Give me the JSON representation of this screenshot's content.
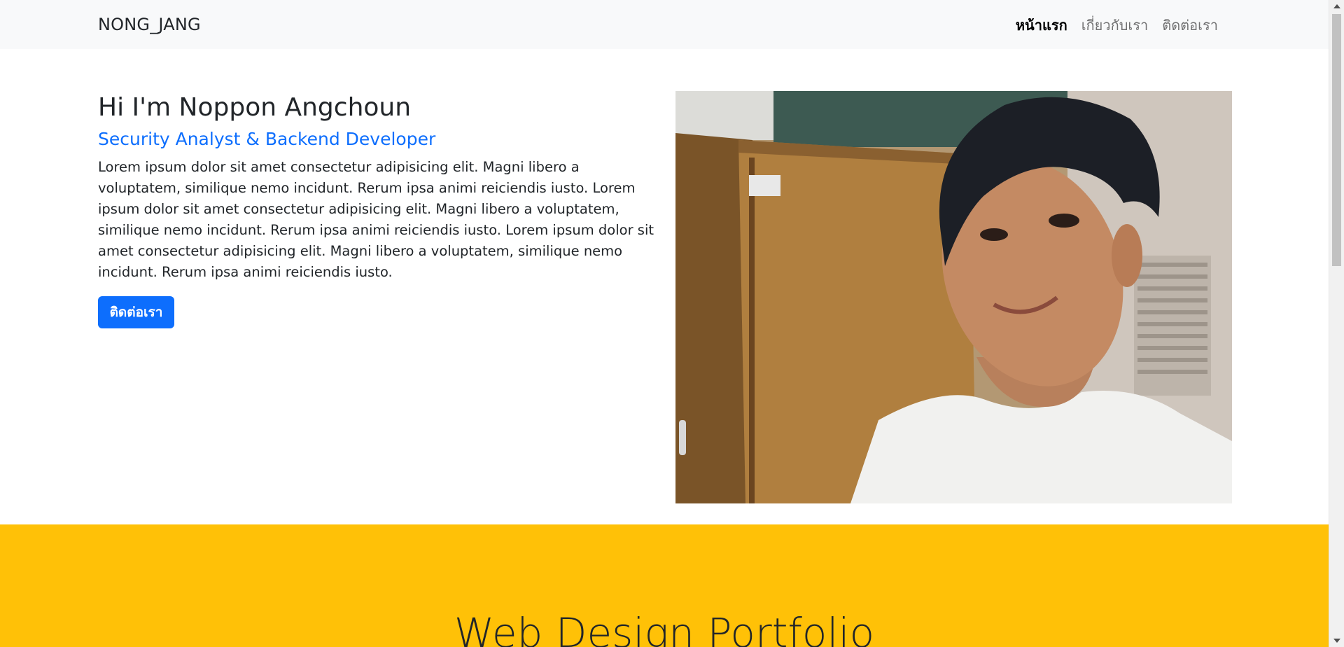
{
  "navbar": {
    "brand": "NONG_JANG",
    "links": [
      {
        "label": "หน้าแรก",
        "active": true
      },
      {
        "label": "เกี่ยวกับเรา",
        "active": false
      },
      {
        "label": "ติดต่อเรา",
        "active": false
      }
    ]
  },
  "hero": {
    "title": "Hi I'm Noppon Angchoun",
    "subtitle": "Security Analyst & Backend Developer",
    "description": "Lorem ipsum dolor sit amet consectetur adipisicing elit. Magni libero a voluptatem, similique nemo incidunt. Rerum ipsa animi reiciendis iusto. Lorem ipsum dolor sit amet consectetur adipisicing elit. Magni libero a voluptatem, similique nemo incidunt. Rerum ipsa animi reiciendis iusto. Lorem ipsum dolor sit amet consectetur adipisicing elit. Magni libero a voluptatem, similique nemo incidunt. Rerum ipsa animi reiciendis iusto.",
    "button_label": "ติดต่อเรา"
  },
  "portfolio": {
    "title": "Web Design Portfolio"
  },
  "colors": {
    "navbar_bg": "#f8f9fa",
    "accent_blue": "#0d6efd",
    "section_yellow": "#ffc107",
    "text_dark": "#212529"
  }
}
